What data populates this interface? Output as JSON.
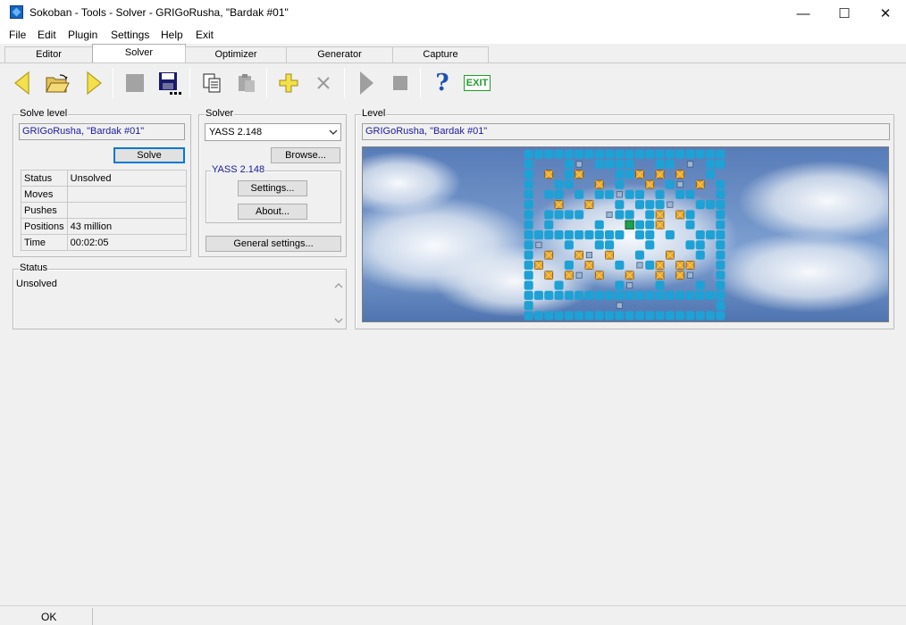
{
  "window": {
    "title": "Sokoban - Tools - Solver - GRIGoRusha, \"Bardak #01\"",
    "controls": {
      "minimize": "—",
      "maximize": "☐",
      "close": "✕"
    }
  },
  "menu": [
    "File",
    "Edit",
    "Plugin",
    "Settings",
    "Help",
    "Exit"
  ],
  "tabs": [
    "Editor",
    "Solver",
    "Optimizer",
    "Generator",
    "Capture"
  ],
  "active_tab": "Solver",
  "toolbar": {
    "icons": [
      "previous-arrow-icon",
      "open-folder-icon",
      "next-arrow-icon",
      "stop-square-icon",
      "save-disk-icon",
      "copy-icon",
      "paste-icon",
      "add-plus-icon",
      "delete-x-icon",
      "play-icon",
      "stop-icon",
      "help-icon",
      "exit-icon"
    ],
    "help_label": "?",
    "exit_label": "EXIT",
    "colors": {
      "arrow": "#f2e14c",
      "help": "#1c4fb8",
      "exit": "#1f9e2a"
    }
  },
  "solve_level": {
    "legend": "Solve level",
    "level_name": "GRIGoRusha, \"Bardak #01\"",
    "solve_button": "Solve",
    "rows": [
      {
        "label": "Status",
        "value": "Unsolved"
      },
      {
        "label": "Moves",
        "value": ""
      },
      {
        "label": "Pushes",
        "value": ""
      },
      {
        "label": "Positions",
        "value": "43 million"
      },
      {
        "label": "Time",
        "value": "00:02:05"
      }
    ]
  },
  "solver": {
    "legend": "Solver",
    "selected": "YASS 2.148",
    "browse_button": "Browse...",
    "sub_legend": "YASS 2.148",
    "settings_button": "Settings...",
    "about_button": "About...",
    "general_settings_button": "General settings..."
  },
  "status": {
    "legend": "Status",
    "text": "Unsolved"
  },
  "level": {
    "legend": "Level",
    "name": "GRIGoRusha, \"Bardak #01\"",
    "colors": {
      "wall": "#1ea1d4",
      "sky": "#6b8fc4",
      "box": "#e8a526",
      "goal": "#9fb6cf"
    }
  },
  "statusbar": {
    "text": "OK"
  }
}
